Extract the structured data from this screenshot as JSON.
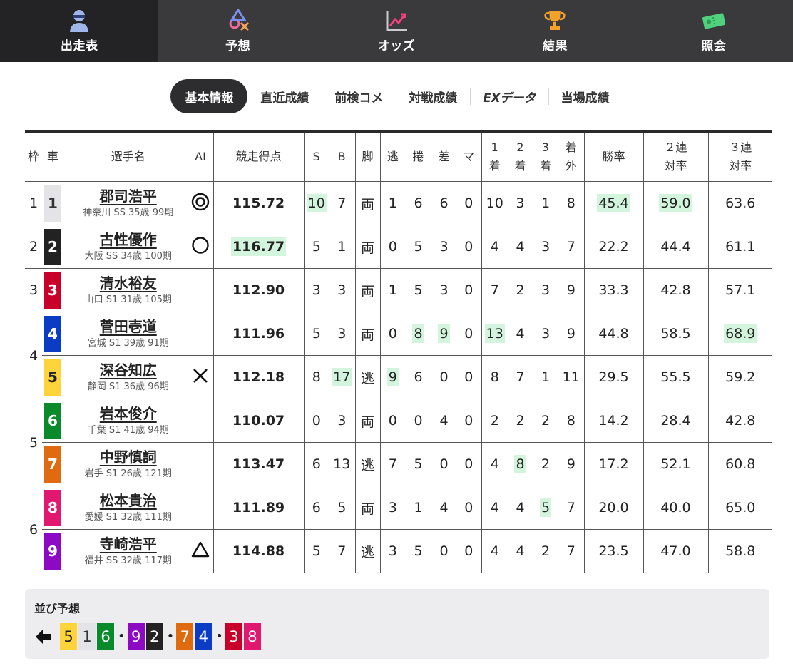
{
  "nav": [
    {
      "label": "出走表",
      "icon": "racer-helmet-icon",
      "active": true
    },
    {
      "label": "予想",
      "icon": "prediction-symbols-icon",
      "active": false
    },
    {
      "label": "オッズ",
      "icon": "odds-chart-icon",
      "active": false
    },
    {
      "label": "結果",
      "icon": "trophy-icon",
      "active": false
    },
    {
      "label": "照会",
      "icon": "ticket-icon",
      "active": false
    }
  ],
  "tabs": [
    {
      "label": "基本情報",
      "active": true
    },
    {
      "label": "直近成績",
      "active": false
    },
    {
      "label": "前検コメ",
      "active": false
    },
    {
      "label": "対戦成績",
      "active": false
    },
    {
      "label": "EXデータ",
      "active": false
    },
    {
      "label": "当場成績",
      "active": false
    }
  ],
  "headers": {
    "waku": "枠",
    "car": "車",
    "name": "選手名",
    "ai": "AI",
    "score": "競走得点",
    "s": "S",
    "b": "B",
    "leg": "脚",
    "nige": "逃",
    "makuri": "捲",
    "sashi": "差",
    "ma": "マ",
    "first": [
      "1",
      "着"
    ],
    "second": [
      "2",
      "着"
    ],
    "third": [
      "3",
      "着"
    ],
    "out": [
      "着",
      "外"
    ],
    "win": "勝率",
    "quinella": [
      "２連",
      "対率"
    ],
    "trio": [
      "３連",
      "対率"
    ]
  },
  "wakus": [
    {
      "waku": "1",
      "cars": [
        1
      ]
    },
    {
      "waku": "2",
      "cars": [
        2
      ]
    },
    {
      "waku": "3",
      "cars": [
        3
      ]
    },
    {
      "waku": "4",
      "cars": [
        4,
        5
      ]
    },
    {
      "waku": "5",
      "cars": [
        6,
        7
      ]
    },
    {
      "waku": "6",
      "cars": [
        8,
        9
      ]
    }
  ],
  "car_colors": {
    "1": {
      "bg": "#e4e4e8",
      "fg": "#333333"
    },
    "2": {
      "bg": "#222222",
      "fg": "#ffffff"
    },
    "3": {
      "bg": "#c9002a",
      "fg": "#ffffff"
    },
    "4": {
      "bg": "#0b3cc4",
      "fg": "#ffffff"
    },
    "5": {
      "bg": "#ffd43a",
      "fg": "#222222"
    },
    "6": {
      "bg": "#0a8a2a",
      "fg": "#ffffff"
    },
    "7": {
      "bg": "#e06a10",
      "fg": "#ffffff"
    },
    "8": {
      "bg": "#e0186f",
      "fg": "#ffffff"
    },
    "9": {
      "bg": "#8c0ac4",
      "fg": "#ffffff"
    }
  },
  "highlight_color": "#d4f5dd",
  "racers": [
    {
      "car": "1",
      "name": "郡司浩平",
      "info": "神奈川 SS 35歳 99期",
      "ai": "◎",
      "ai_icon": "double-circle-icon",
      "score": "115.72",
      "s": "10",
      "b": "7",
      "leg": "両",
      "nige": "1",
      "makuri": "6",
      "sashi": "6",
      "ma": "0",
      "first": "10",
      "second": "3",
      "third": "1",
      "out": "8",
      "win": "45.4",
      "quinella": "59.0",
      "trio": "63.6",
      "hl": [
        "s",
        "win",
        "quinella"
      ]
    },
    {
      "car": "2",
      "name": "古性優作",
      "info": "大阪 SS 34歳 100期",
      "ai": "○",
      "ai_icon": "circle-icon",
      "score": "116.77",
      "s": "5",
      "b": "1",
      "leg": "両",
      "nige": "0",
      "makuri": "5",
      "sashi": "3",
      "ma": "0",
      "first": "4",
      "second": "4",
      "third": "3",
      "out": "7",
      "win": "22.2",
      "quinella": "44.4",
      "trio": "61.1",
      "hl": [
        "score"
      ]
    },
    {
      "car": "3",
      "name": "清水裕友",
      "info": "山口 S1 31歳 105期",
      "ai": "",
      "ai_icon": "",
      "score": "112.90",
      "s": "3",
      "b": "3",
      "leg": "両",
      "nige": "1",
      "makuri": "5",
      "sashi": "3",
      "ma": "0",
      "first": "7",
      "second": "2",
      "third": "3",
      "out": "9",
      "win": "33.3",
      "quinella": "42.8",
      "trio": "57.1",
      "hl": []
    },
    {
      "car": "4",
      "name": "菅田壱道",
      "info": "宮城 S1 39歳 91期",
      "ai": "",
      "ai_icon": "",
      "score": "111.96",
      "s": "5",
      "b": "3",
      "leg": "両",
      "nige": "0",
      "makuri": "8",
      "sashi": "9",
      "ma": "0",
      "first": "13",
      "second": "4",
      "third": "3",
      "out": "9",
      "win": "44.8",
      "quinella": "58.5",
      "trio": "68.9",
      "hl": [
        "makuri",
        "sashi",
        "first",
        "trio"
      ]
    },
    {
      "car": "5",
      "name": "深谷知広",
      "info": "静岡 S1 36歳 96期",
      "ai": "×",
      "ai_icon": "cross-icon",
      "score": "112.18",
      "s": "8",
      "b": "17",
      "leg": "逃",
      "nige": "9",
      "makuri": "6",
      "sashi": "0",
      "ma": "0",
      "first": "8",
      "second": "7",
      "third": "1",
      "out": "11",
      "win": "29.5",
      "quinella": "55.5",
      "trio": "59.2",
      "hl": [
        "b",
        "nige"
      ]
    },
    {
      "car": "6",
      "name": "岩本俊介",
      "info": "千葉 S1 41歳 94期",
      "ai": "",
      "ai_icon": "",
      "score": "110.07",
      "s": "0",
      "b": "3",
      "leg": "両",
      "nige": "0",
      "makuri": "0",
      "sashi": "4",
      "ma": "0",
      "first": "2",
      "second": "2",
      "third": "2",
      "out": "8",
      "win": "14.2",
      "quinella": "28.4",
      "trio": "42.8",
      "hl": []
    },
    {
      "car": "7",
      "name": "中野慎詞",
      "info": "岩手 S1 26歳 121期",
      "ai": "",
      "ai_icon": "",
      "score": "113.47",
      "s": "6",
      "b": "13",
      "leg": "逃",
      "nige": "7",
      "makuri": "5",
      "sashi": "0",
      "ma": "0",
      "first": "4",
      "second": "8",
      "third": "2",
      "out": "9",
      "win": "17.2",
      "quinella": "52.1",
      "trio": "60.8",
      "hl": [
        "second"
      ]
    },
    {
      "car": "8",
      "name": "松本貴治",
      "info": "愛媛 S1 32歳 111期",
      "ai": "",
      "ai_icon": "",
      "score": "111.89",
      "s": "6",
      "b": "5",
      "leg": "両",
      "nige": "3",
      "makuri": "1",
      "sashi": "4",
      "ma": "0",
      "first": "4",
      "second": "4",
      "third": "5",
      "out": "7",
      "win": "20.0",
      "quinella": "40.0",
      "trio": "65.0",
      "hl": [
        "third"
      ]
    },
    {
      "car": "9",
      "name": "寺崎浩平",
      "info": "福井 SS 32歳 117期",
      "ai": "△",
      "ai_icon": "triangle-icon",
      "score": "114.88",
      "s": "5",
      "b": "7",
      "leg": "逃",
      "nige": "3",
      "makuri": "5",
      "sashi": "0",
      "ma": "0",
      "first": "4",
      "second": "4",
      "third": "2",
      "out": "7",
      "win": "23.5",
      "quinella": "47.0",
      "trio": "58.8",
      "hl": []
    }
  ],
  "line_prediction": {
    "title": "並び予想",
    "arrow_icon": "arrow-left-icon",
    "groups": [
      [
        "5",
        "1",
        "6"
      ],
      [
        "9",
        "2"
      ],
      [
        "7",
        "4"
      ],
      [
        "3",
        "8"
      ]
    ],
    "separator": "•"
  }
}
